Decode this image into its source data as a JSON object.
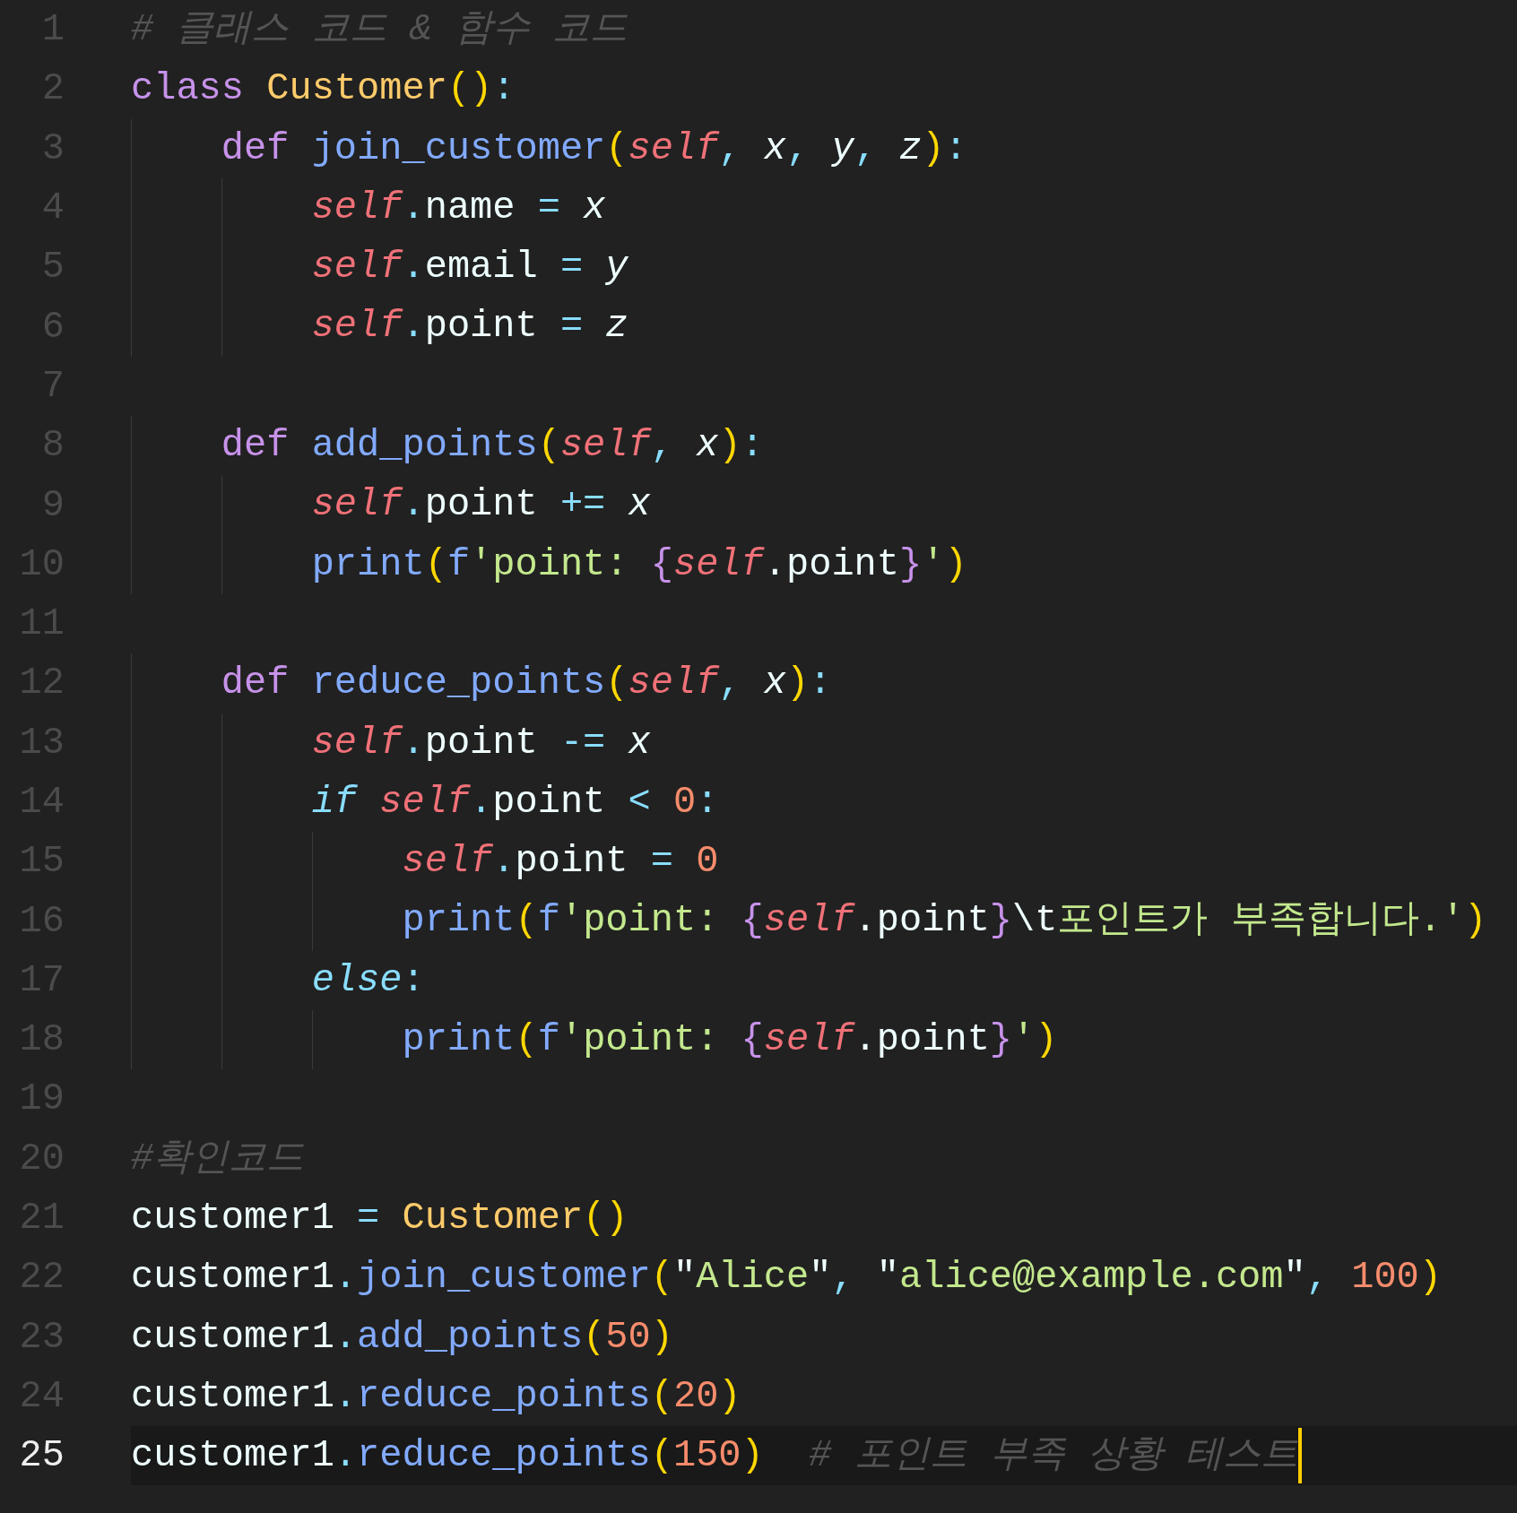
{
  "editor": {
    "lines": [
      {
        "number": "1",
        "current": false,
        "tokens": [
          {
            "kind": "comment",
            "text": "# 클래스 코드 & 함수 코드"
          }
        ]
      },
      {
        "number": "2",
        "current": false,
        "tokens": [
          {
            "kind": "keyword",
            "text": "class "
          },
          {
            "kind": "classname",
            "text": "Customer"
          },
          {
            "kind": "paren",
            "text": "()"
          },
          {
            "kind": "punct",
            "text": ":"
          }
        ]
      },
      {
        "number": "3",
        "current": false,
        "tokens": [
          {
            "kind": "keyword",
            "text": "    def "
          },
          {
            "kind": "function",
            "text": "join_customer"
          },
          {
            "kind": "paren",
            "text": "("
          },
          {
            "kind": "self",
            "text": "self"
          },
          {
            "kind": "punct",
            "text": ", "
          },
          {
            "kind": "param",
            "text": "x"
          },
          {
            "kind": "punct",
            "text": ", "
          },
          {
            "kind": "param",
            "text": "y"
          },
          {
            "kind": "punct",
            "text": ", "
          },
          {
            "kind": "param",
            "text": "z"
          },
          {
            "kind": "paren",
            "text": ")"
          },
          {
            "kind": "punct",
            "text": ":"
          }
        ]
      },
      {
        "number": "4",
        "current": false,
        "tokens": [
          {
            "kind": "self",
            "text": "        self"
          },
          {
            "kind": "punct",
            "text": "."
          },
          {
            "kind": "plain",
            "text": "name "
          },
          {
            "kind": "punct",
            "text": "= "
          },
          {
            "kind": "param",
            "text": "x"
          }
        ]
      },
      {
        "number": "5",
        "current": false,
        "tokens": [
          {
            "kind": "self",
            "text": "        self"
          },
          {
            "kind": "punct",
            "text": "."
          },
          {
            "kind": "plain",
            "text": "email "
          },
          {
            "kind": "punct",
            "text": "= "
          },
          {
            "kind": "param",
            "text": "y"
          }
        ]
      },
      {
        "number": "6",
        "current": false,
        "tokens": [
          {
            "kind": "self",
            "text": "        self"
          },
          {
            "kind": "punct",
            "text": "."
          },
          {
            "kind": "plain",
            "text": "point "
          },
          {
            "kind": "punct",
            "text": "= "
          },
          {
            "kind": "param",
            "text": "z"
          }
        ]
      },
      {
        "number": "7",
        "current": false
      },
      {
        "number": "8",
        "current": false,
        "tokens": [
          {
            "kind": "keyword",
            "text": "    def "
          },
          {
            "kind": "function",
            "text": "add_points"
          },
          {
            "kind": "paren",
            "text": "("
          },
          {
            "kind": "self",
            "text": "self"
          },
          {
            "kind": "punct",
            "text": ", "
          },
          {
            "kind": "param",
            "text": "x"
          },
          {
            "kind": "paren",
            "text": ")"
          },
          {
            "kind": "punct",
            "text": ":"
          }
        ]
      },
      {
        "number": "9",
        "current": false,
        "tokens": [
          {
            "kind": "self",
            "text": "        self"
          },
          {
            "kind": "punct",
            "text": "."
          },
          {
            "kind": "plain",
            "text": "point "
          },
          {
            "kind": "punct",
            "text": "+= "
          },
          {
            "kind": "param",
            "text": "x"
          }
        ]
      },
      {
        "number": "10",
        "current": false,
        "tokens": [
          {
            "kind": "function",
            "text": "        print"
          },
          {
            "kind": "paren",
            "text": "("
          },
          {
            "kind": "function",
            "text": "f"
          },
          {
            "kind": "string",
            "text": "'point: "
          },
          {
            "kind": "brace",
            "text": "{"
          },
          {
            "kind": "self",
            "text": "self"
          },
          {
            "kind": "plain",
            "text": ".point"
          },
          {
            "kind": "brace",
            "text": "}"
          },
          {
            "kind": "string",
            "text": "'"
          },
          {
            "kind": "paren",
            "text": ")"
          }
        ]
      },
      {
        "number": "11",
        "current": false
      },
      {
        "number": "12",
        "current": false,
        "tokens": [
          {
            "kind": "keyword",
            "text": "    def "
          },
          {
            "kind": "function",
            "text": "reduce_points"
          },
          {
            "kind": "paren",
            "text": "("
          },
          {
            "kind": "self",
            "text": "self"
          },
          {
            "kind": "punct",
            "text": ", "
          },
          {
            "kind": "param",
            "text": "x"
          },
          {
            "kind": "paren",
            "text": ")"
          },
          {
            "kind": "punct",
            "text": ":"
          }
        ]
      },
      {
        "number": "13",
        "current": false,
        "tokens": [
          {
            "kind": "self",
            "text": "        self"
          },
          {
            "kind": "punct",
            "text": "."
          },
          {
            "kind": "plain",
            "text": "point "
          },
          {
            "kind": "punct",
            "text": "-= "
          },
          {
            "kind": "param",
            "text": "x"
          }
        ]
      },
      {
        "number": "14",
        "current": false,
        "tokens": [
          {
            "kind": "control",
            "text": "        if "
          },
          {
            "kind": "self",
            "text": "self"
          },
          {
            "kind": "punct",
            "text": "."
          },
          {
            "kind": "plain",
            "text": "point "
          },
          {
            "kind": "punct",
            "text": "< "
          },
          {
            "kind": "number",
            "text": "0"
          },
          {
            "kind": "punct",
            "text": ":"
          }
        ]
      },
      {
        "number": "15",
        "current": false,
        "tokens": [
          {
            "kind": "self",
            "text": "            self"
          },
          {
            "kind": "punct",
            "text": "."
          },
          {
            "kind": "plain",
            "text": "point "
          },
          {
            "kind": "punct",
            "text": "= "
          },
          {
            "kind": "number",
            "text": "0"
          }
        ]
      },
      {
        "number": "16",
        "current": false,
        "tokens": [
          {
            "kind": "function",
            "text": "            print"
          },
          {
            "kind": "paren",
            "text": "("
          },
          {
            "kind": "function",
            "text": "f"
          },
          {
            "kind": "string",
            "text": "'point: "
          },
          {
            "kind": "brace",
            "text": "{"
          },
          {
            "kind": "self",
            "text": "self"
          },
          {
            "kind": "plain",
            "text": ".point"
          },
          {
            "kind": "brace",
            "text": "}"
          },
          {
            "kind": "plain",
            "text": "\\t"
          },
          {
            "kind": "string",
            "text": "포인트가 부족합니다.'"
          },
          {
            "kind": "paren",
            "text": ")"
          }
        ]
      },
      {
        "number": "17",
        "current": false,
        "tokens": [
          {
            "kind": "control",
            "text": "        else"
          },
          {
            "kind": "punct",
            "text": ":"
          }
        ]
      },
      {
        "number": "18",
        "current": false,
        "tokens": [
          {
            "kind": "function",
            "text": "            print"
          },
          {
            "kind": "paren",
            "text": "("
          },
          {
            "kind": "function",
            "text": "f"
          },
          {
            "kind": "string",
            "text": "'point: "
          },
          {
            "kind": "brace",
            "text": "{"
          },
          {
            "kind": "self",
            "text": "self"
          },
          {
            "kind": "plain",
            "text": ".point"
          },
          {
            "kind": "brace",
            "text": "}"
          },
          {
            "kind": "string",
            "text": "'"
          },
          {
            "kind": "paren",
            "text": ")"
          }
        ]
      },
      {
        "number": "19",
        "current": false
      },
      {
        "number": "20",
        "current": false,
        "tokens": [
          {
            "kind": "comment",
            "text": "#확인코드"
          }
        ]
      },
      {
        "number": "21",
        "current": false,
        "tokens": [
          {
            "kind": "plain",
            "text": "customer1 "
          },
          {
            "kind": "punct",
            "text": "= "
          },
          {
            "kind": "classname",
            "text": "Customer"
          },
          {
            "kind": "paren",
            "text": "()"
          }
        ]
      },
      {
        "number": "22",
        "current": false,
        "tokens": [
          {
            "kind": "plain",
            "text": "customer1"
          },
          {
            "kind": "punct",
            "text": "."
          },
          {
            "kind": "function",
            "text": "join_customer"
          },
          {
            "kind": "paren",
            "text": "("
          },
          {
            "kind": "plain",
            "text": "\""
          },
          {
            "kind": "string",
            "text": "Alice"
          },
          {
            "kind": "plain",
            "text": "\""
          },
          {
            "kind": "punct",
            "text": ", "
          },
          {
            "kind": "plain",
            "text": "\""
          },
          {
            "kind": "string",
            "text": "alice@example.com"
          },
          {
            "kind": "plain",
            "text": "\""
          },
          {
            "kind": "punct",
            "text": ", "
          },
          {
            "kind": "number",
            "text": "100"
          },
          {
            "kind": "paren",
            "text": ")"
          }
        ]
      },
      {
        "number": "23",
        "current": false,
        "tokens": [
          {
            "kind": "plain",
            "text": "customer1"
          },
          {
            "kind": "punct",
            "text": "."
          },
          {
            "kind": "function",
            "text": "add_points"
          },
          {
            "kind": "paren",
            "text": "("
          },
          {
            "kind": "number",
            "text": "50"
          },
          {
            "kind": "paren",
            "text": ")"
          }
        ]
      },
      {
        "number": "24",
        "current": false,
        "tokens": [
          {
            "kind": "plain",
            "text": "customer1"
          },
          {
            "kind": "punct",
            "text": "."
          },
          {
            "kind": "function",
            "text": "reduce_points"
          },
          {
            "kind": "paren",
            "text": "("
          },
          {
            "kind": "number",
            "text": "20"
          },
          {
            "kind": "paren",
            "text": ")"
          }
        ]
      },
      {
        "number": "25",
        "current": true,
        "tokens": [
          {
            "kind": "plain",
            "text": "customer1"
          },
          {
            "kind": "punct",
            "text": "."
          },
          {
            "kind": "function",
            "text": "reduce_points"
          },
          {
            "kind": "paren",
            "text": "("
          },
          {
            "kind": "number",
            "text": "150"
          },
          {
            "kind": "paren",
            "text": ")"
          },
          {
            "kind": "comment",
            "text": "  # 포인트 부족 상황 테스트"
          }
        ]
      }
    ]
  }
}
